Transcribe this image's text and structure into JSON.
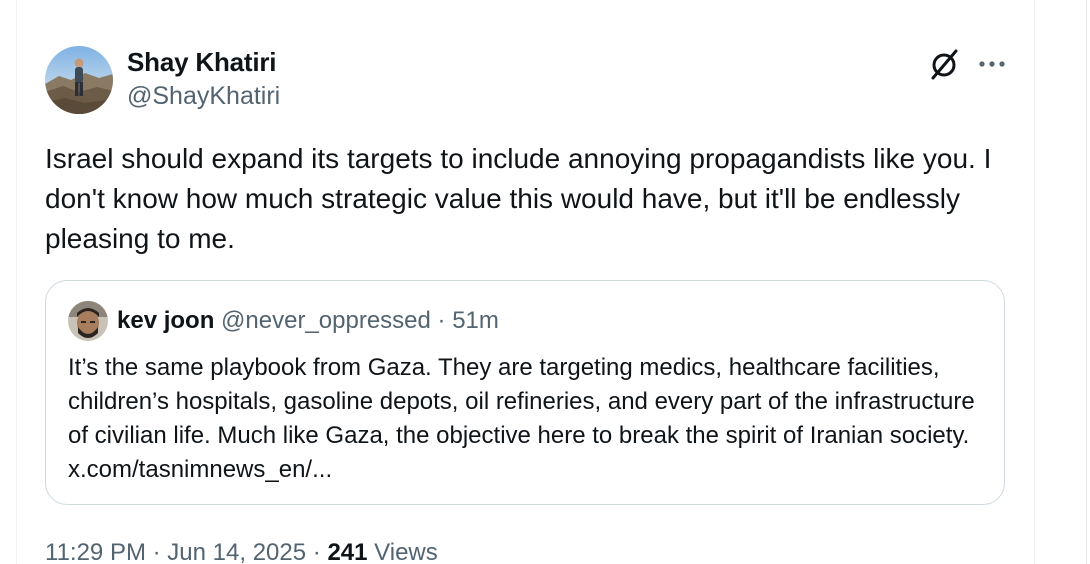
{
  "author": {
    "display_name": "Shay Khatiri",
    "handle": "@ShayKhatiri"
  },
  "tweet": {
    "text": "Israel should expand its targets to include annoying propagandists like you. I don't know how much strategic value this would have, but it'll be endlessly pleasing to me."
  },
  "quoted": {
    "display_name": "kev joon",
    "handle": "@never_oppressed",
    "separator": "·",
    "time": "51m",
    "text": "It’s the same playbook from Gaza. They are targeting medics, healthcare facilities, children’s hospitals, gasoline depots, oil refineries, and every part of the infrastructure of civilian life. Much like Gaza, the objective here to break the spirit of Iranian society. x.com/tasnimnews_en/..."
  },
  "meta": {
    "time": "11:29 PM",
    "sep1": "·",
    "date": "Jun 14, 2025",
    "sep2": "·",
    "views_count": "241",
    "views_label": "Views"
  },
  "icons": {
    "grok": "grok-icon",
    "more": "more-icon"
  },
  "colors": {
    "text_primary": "#0f1419",
    "text_secondary": "#536471",
    "border": "#cfd9de"
  }
}
